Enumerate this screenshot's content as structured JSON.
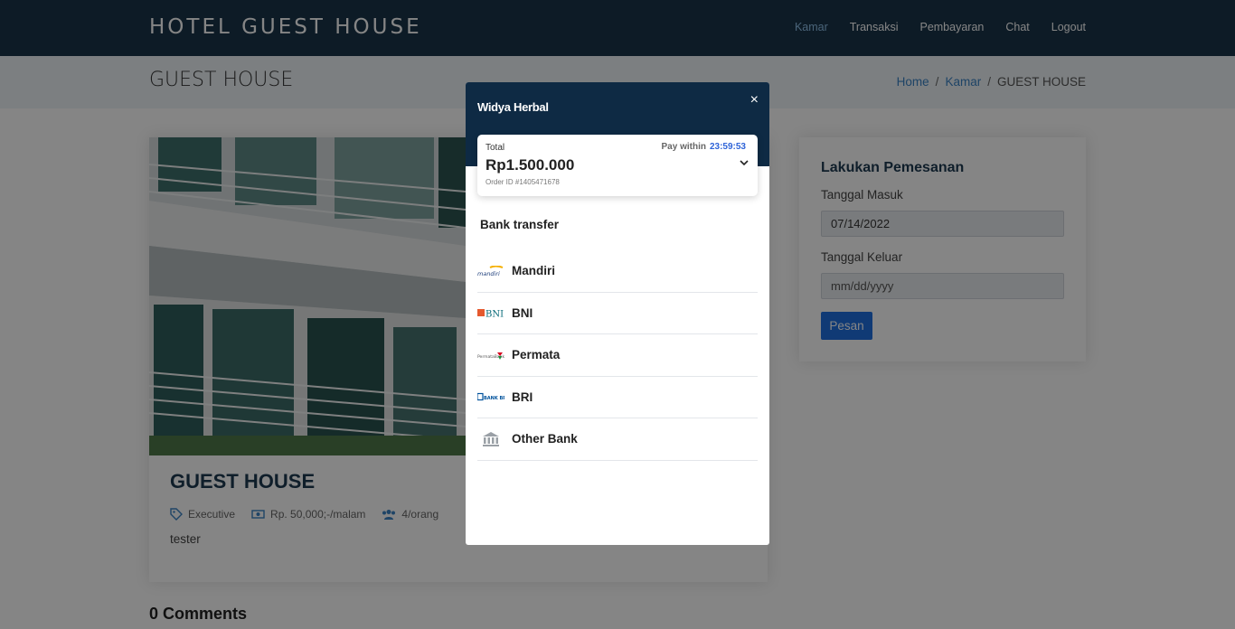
{
  "header": {
    "brand": "HOTEL GUEST HOUSE",
    "nav": [
      "Kamar",
      "Transaksi",
      "Pembayaran",
      "Chat",
      "Logout"
    ]
  },
  "banner": {
    "title": "GUEST HOUSE",
    "breadcrumb": {
      "home": "Home",
      "section": "Kamar",
      "current": "GUEST HOUSE",
      "separator": "/"
    }
  },
  "room": {
    "name": "GUEST HOUSE",
    "type": "Executive",
    "price": "Rp. 50,000;-/malam",
    "capacity": "4/orang",
    "description": "tester"
  },
  "comments": {
    "title": "0 Comments"
  },
  "booking": {
    "title": "Lakukan Pemesanan",
    "checkin_label": "Tanggal Masuk",
    "checkin_value": "07/14/2022",
    "checkout_label": "Tanggal Keluar",
    "checkout_placeholder": "mm/dd/yyyy",
    "submit_label": "Pesan"
  },
  "payment_modal": {
    "merchant": "Widya Herbal",
    "close": "×",
    "total_label": "Total",
    "pay_within_label": "Pay within",
    "timer": "23:59:53",
    "amount": "Rp1.500.000",
    "order_id": "Order ID #1405471678",
    "section_title": "Bank transfer",
    "banks": [
      {
        "name": "Mandiri",
        "logo": "mandiri-logo"
      },
      {
        "name": "BNI",
        "logo": "bni-logo"
      },
      {
        "name": "Permata",
        "logo": "permata-logo"
      },
      {
        "name": "BRI",
        "logo": "bri-logo"
      },
      {
        "name": "Other Bank",
        "logo": "bank-building-icon"
      }
    ],
    "colors": {
      "header": "#0e2a44",
      "timer": "#2e63d8"
    }
  },
  "colors": {
    "topbar": "#19354a",
    "accent": "#1f6fe0",
    "title": "#1d3a52"
  }
}
